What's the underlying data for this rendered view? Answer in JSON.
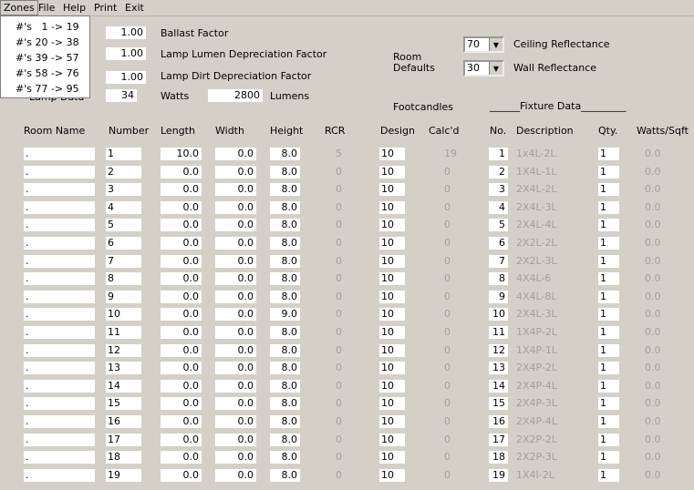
{
  "menu": {
    "items": [
      "Zones",
      "File",
      "Help",
      "Print",
      "Exit"
    ],
    "zones_dropdown": [
      "#'s   1 -> 19",
      "#'s 20 -> 38",
      "#'s 39 -> 57",
      "#'s 58 -> 76",
      "#'s 77 -> 95"
    ]
  },
  "factors": {
    "ballast_value": "1.00",
    "ballast_label": "Ballast Factor",
    "lumen_dep_value": "1.00",
    "lumen_dep_label": "Lamp Lumen Depreciation Factor",
    "dirt_dep_value": "1.00",
    "dirt_dep_label": "Lamp Dirt Depreciation Factor",
    "lamp_data_label": "Lamp Data",
    "watts_value": "34",
    "watts_label": "Watts",
    "lumens_value": "2800",
    "lumens_label": "Lumens"
  },
  "room_defaults": {
    "label_line1": "Room",
    "label_line2": "Defaults",
    "ceiling_value": "70",
    "ceiling_label": "Ceiling Reflectance",
    "wall_value": "30",
    "wall_label": "Wall Reflectance"
  },
  "section_titles": {
    "footcandles": "Footcandles",
    "fixture_data": "______Fixture Data_________"
  },
  "columns": {
    "room_name": "Room Name",
    "number": "Number",
    "length": "Length",
    "width": "Width",
    "height": "Height",
    "rcr": "RCR",
    "design": "Design",
    "calcd": "Calc'd",
    "no": "No.",
    "description": "Description",
    "qty": "Qty.",
    "watts_sqft": "Watts/Sqft"
  },
  "rows": [
    {
      "name": ".",
      "number": "1",
      "length": "10.0",
      "width": "0.0",
      "height": "8.0",
      "rcr": "5",
      "design": "10",
      "calcd": "19",
      "no": "1",
      "desc": "1x4L-2L",
      "qty": "1",
      "wsf": "0.0"
    },
    {
      "name": ".",
      "number": "2",
      "length": "0.0",
      "width": "0.0",
      "height": "8.0",
      "rcr": "0",
      "design": "10",
      "calcd": "0",
      "no": "2",
      "desc": "1X4L-1L",
      "qty": "1",
      "wsf": "0.0"
    },
    {
      "name": ".",
      "number": "3",
      "length": "0.0",
      "width": "0.0",
      "height": "8.0",
      "rcr": "0",
      "design": "10",
      "calcd": "0",
      "no": "3",
      "desc": "2X4L-2L",
      "qty": "1",
      "wsf": "0.0"
    },
    {
      "name": ".",
      "number": "4",
      "length": "0.0",
      "width": "0.0",
      "height": "8.0",
      "rcr": "0",
      "design": "10",
      "calcd": "0",
      "no": "4",
      "desc": "2X4L-3L",
      "qty": "1",
      "wsf": "0.0"
    },
    {
      "name": ".",
      "number": "5",
      "length": "0.0",
      "width": "0.0",
      "height": "8.0",
      "rcr": "0",
      "design": "10",
      "calcd": "0",
      "no": "5",
      "desc": "2X4L-4L",
      "qty": "1",
      "wsf": "0.0"
    },
    {
      "name": ".",
      "number": "6",
      "length": "0.0",
      "width": "0.0",
      "height": "8.0",
      "rcr": "0",
      "design": "10",
      "calcd": "0",
      "no": "6",
      "desc": "2X2L-2L",
      "qty": "1",
      "wsf": "0.0"
    },
    {
      "name": ".",
      "number": "7",
      "length": "0.0",
      "width": "0.0",
      "height": "8.0",
      "rcr": "0",
      "design": "10",
      "calcd": "0",
      "no": "7",
      "desc": "2X2L-3L",
      "qty": "1",
      "wsf": "0.0"
    },
    {
      "name": ".",
      "number": "8",
      "length": "0.0",
      "width": "0.0",
      "height": "8.0",
      "rcr": "0",
      "design": "10",
      "calcd": "0",
      "no": "8",
      "desc": "4X4L-6",
      "qty": "1",
      "wsf": "0.0"
    },
    {
      "name": ".",
      "number": "9",
      "length": "0.0",
      "width": "0.0",
      "height": "8.0",
      "rcr": "0",
      "design": "10",
      "calcd": "0",
      "no": "9",
      "desc": "4X4L-8L",
      "qty": "1",
      "wsf": "0.0"
    },
    {
      "name": ".",
      "number": "10",
      "length": "0.0",
      "width": "0.0",
      "height": "9.0",
      "rcr": "0",
      "design": "10",
      "calcd": "0",
      "no": "10",
      "desc": "2X4L-3L",
      "qty": "1",
      "wsf": "0.0"
    },
    {
      "name": ".",
      "number": "11",
      "length": "0.0",
      "width": "0.0",
      "height": "8.0",
      "rcr": "0",
      "design": "10",
      "calcd": "0",
      "no": "11",
      "desc": "1X4P-2L",
      "qty": "1",
      "wsf": "0.0"
    },
    {
      "name": ".",
      "number": "12",
      "length": "0.0",
      "width": "0.0",
      "height": "8.0",
      "rcr": "0",
      "design": "10",
      "calcd": "0",
      "no": "12",
      "desc": "1X4P-1L",
      "qty": "1",
      "wsf": "0.0"
    },
    {
      "name": ".",
      "number": "13",
      "length": "0.0",
      "width": "0.0",
      "height": "8.0",
      "rcr": "0",
      "design": "10",
      "calcd": "0",
      "no": "13",
      "desc": "2X4P-2L",
      "qty": "1",
      "wsf": "0.0"
    },
    {
      "name": ".",
      "number": "14",
      "length": "0.0",
      "width": "0.0",
      "height": "8.0",
      "rcr": "0",
      "design": "10",
      "calcd": "0",
      "no": "14",
      "desc": "2X4P-4L",
      "qty": "1",
      "wsf": "0.0"
    },
    {
      "name": ".",
      "number": "15",
      "length": "0.0",
      "width": "0.0",
      "height": "8.0",
      "rcr": "0",
      "design": "10",
      "calcd": "0",
      "no": "15",
      "desc": "2X4P-3L",
      "qty": "1",
      "wsf": "0.0"
    },
    {
      "name": ".",
      "number": "16",
      "length": "0.0",
      "width": "0.0",
      "height": "8.0",
      "rcr": "0",
      "design": "10",
      "calcd": "0",
      "no": "16",
      "desc": "2X4P-4L",
      "qty": "1",
      "wsf": "0.0"
    },
    {
      "name": ".",
      "number": "17",
      "length": "0.0",
      "width": "0.0",
      "height": "8.0",
      "rcr": "0",
      "design": "10",
      "calcd": "0",
      "no": "17",
      "desc": "2X2P-2L",
      "qty": "1",
      "wsf": "0.0"
    },
    {
      "name": ".",
      "number": "18",
      "length": "0.0",
      "width": "0.0",
      "height": "8.0",
      "rcr": "0",
      "design": "10",
      "calcd": "0",
      "no": "18",
      "desc": "2X2P-3L",
      "qty": "1",
      "wsf": "0.0"
    },
    {
      "name": ".",
      "number": "19",
      "length": "0.0",
      "width": "0.0",
      "height": "8.0",
      "rcr": "0",
      "design": "10",
      "calcd": "0",
      "no": "19",
      "desc": "1X4I-2L",
      "qty": "1",
      "wsf": "0.0"
    }
  ]
}
